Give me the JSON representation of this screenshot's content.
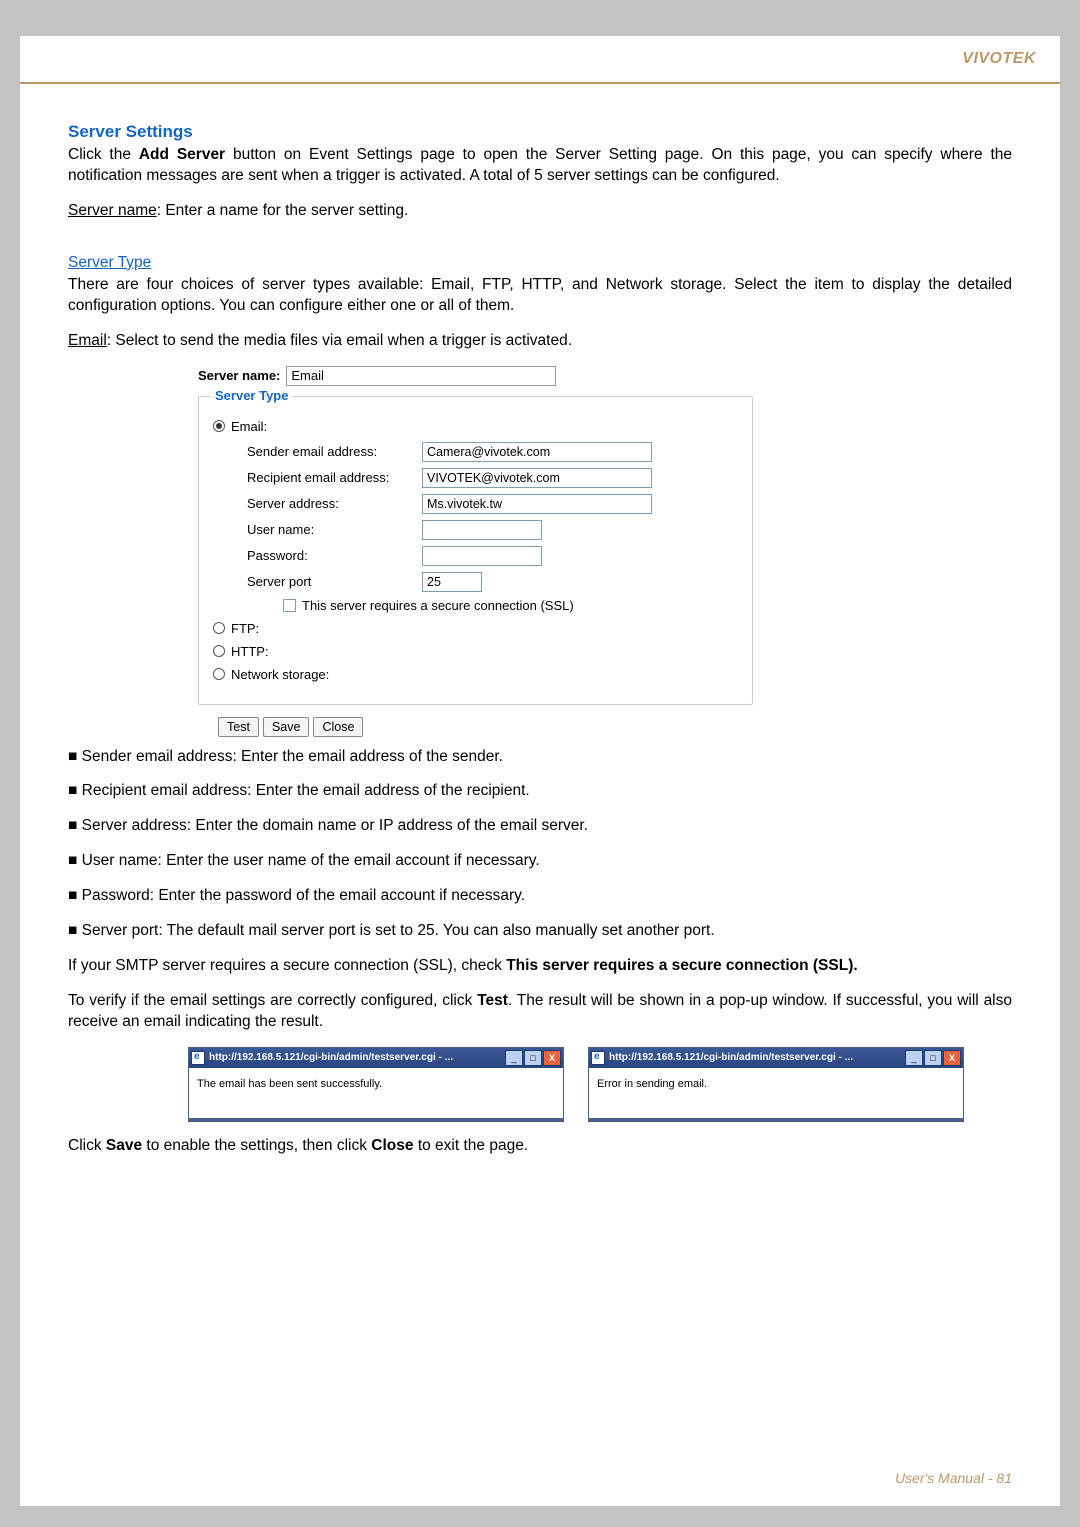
{
  "brand": "VIVOTEK",
  "sections": {
    "title": "Server Settings",
    "intro": "Click the Add Server button on Event Settings page to open the Server Setting page. On this page, you can specify where the notification messages are sent when a trigger is activated. A total of 5 server settings can be configured.",
    "server_name_label": "Server name",
    "server_name_desc": ": Enter a name for the server setting.",
    "server_type_label": "Server Type",
    "server_type_desc": "There are four choices of server types available: Email, FTP, HTTP, and Network storage. Select the item to display the detailed configuration options. You can configure either one or all of them.",
    "email_label": "Email",
    "email_desc": ": Select to send the media files via email when a trigger is activated."
  },
  "form": {
    "server_name_label": "Server name:",
    "server_name_value": "Email",
    "legend": "Server Type",
    "options": {
      "email": "Email:",
      "ftp": "FTP:",
      "http": "HTTP:",
      "network": "Network storage:"
    },
    "fields": {
      "sender_label": "Sender email address:",
      "sender_value": "Camera@vivotek.com",
      "recipient_label": "Recipient email address:",
      "recipient_value": "VIVOTEK@vivotek.com",
      "server_addr_label": "Server address:",
      "server_addr_value": "Ms.vivotek.tw",
      "username_label": "User name:",
      "username_value": "",
      "password_label": "Password:",
      "password_value": "",
      "port_label": "Server port",
      "port_value": "25",
      "ssl_label": "This server requires a secure connection (SSL)"
    },
    "buttons": {
      "test": "Test",
      "save": "Save",
      "close": "Close"
    }
  },
  "bullets": {
    "b1": "■ Sender email address: Enter the email address of the sender.",
    "b2": "■ Recipient email address: Enter the email address of the recipient.",
    "b3": "■ Server address: Enter the domain name or IP address of the email server.",
    "b4": "■ User name: Enter the user name of the email account if necessary.",
    "b5": "■ Password: Enter the password of the email account if necessary.",
    "b6": "■ Server port: The default mail server port is set to 25. You can also manually set another port."
  },
  "ssl_note_pre": "If your SMTP server requires a secure connection (SSL), check ",
  "ssl_note_bold": "This server requires a secure connection (SSL).",
  "verify_pre": "To verify if the email settings are correctly configured, click ",
  "verify_bold": "Test",
  "verify_post": ". The result will be shown in a pop-up window. If successful, you will also receive an email indicating the result.",
  "popups": {
    "title1": "http://192.168.5.121/cgi-bin/admin/testserver.cgi - ...",
    "title2": "http://192.168.5.121/cgi-bin/admin/testserver.cgi - ...",
    "body1": "The email has been sent successfully.",
    "body2": "Error in sending email."
  },
  "save_note_pre": "Click ",
  "save_note_b1": "Save",
  "save_note_mid": " to enable the settings, then click ",
  "save_note_b2": "Close",
  "save_note_post": " to exit the page.",
  "footer_pre": "User's Manual - ",
  "footer_page": "81"
}
